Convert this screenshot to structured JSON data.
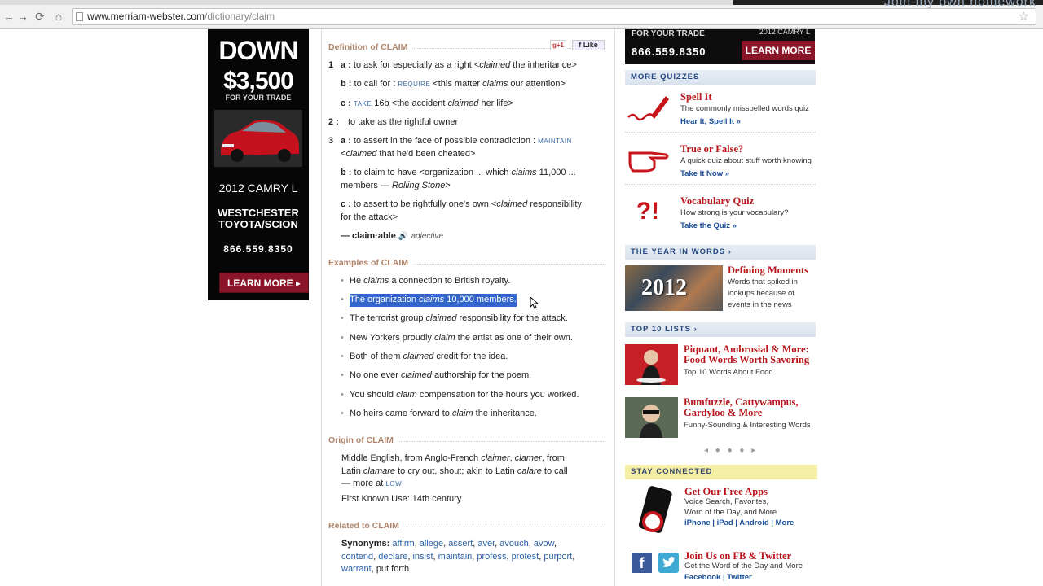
{
  "browser": {
    "tab_text": "Join my own homework",
    "url_host": "www.merriam-webster.com",
    "url_path": "/dictionary/claim",
    "back": "←",
    "forward": "→",
    "reload": "⟳",
    "home": "⌂",
    "star": "☆"
  },
  "left_ad": {
    "down": "DOWN",
    "amount": "$3,500",
    "for_trade": "FOR YOUR TRADE",
    "model": "2012 CAMRY L",
    "dealer": "WESTCHESTER TOYOTA/SCION",
    "phone": "866.559.8350",
    "learn_more": "LEARN MORE ▸"
  },
  "definition": {
    "heading": "Definition of CLAIM",
    "gplus": "g+1",
    "fb_like": "f Like",
    "senses": [
      {
        "num": "1",
        "letter": "a :",
        "text": "to ask for especially as a right <",
        "em": "claimed",
        "rest": " the inheritance>"
      },
      {
        "letter": "b :",
        "pre": "to call for : ",
        "sc": "REQUIRE",
        "text": " <this matter ",
        "em": "claims",
        "rest": " our attention>"
      },
      {
        "letter": "c :",
        "sc": "TAKE",
        "text": " 16b <the accident ",
        "em": "claimed",
        "rest": " her life>"
      },
      {
        "num": "2 :",
        "text": "to take as the rightful owner"
      },
      {
        "num": "3",
        "letter": "a :",
        "text": "to assert in the face of possible contradiction : ",
        "sc": "MAINTAIN",
        "line2_pre": "<",
        "em": "claimed",
        "rest": " that he'd been cheated>"
      },
      {
        "letter": "b :",
        "text": "to claim to have <organization ... which ",
        "em": "claims",
        "rest": " 11,000 ...",
        "line2_pre": "members — ",
        "em2": "Rolling Stone",
        "line2_post": ">"
      },
      {
        "letter": "c :",
        "text": "to assert to be rightfully one's own <",
        "em": "claimed",
        "rest": " responsibility",
        "line2_pre": "for the attack>"
      }
    ],
    "derived_word": "— claim·able",
    "derived_pos": "adjective",
    "speaker_icon": "🔊"
  },
  "examples": {
    "heading": "Examples of CLAIM",
    "items": [
      {
        "pre": "He ",
        "em": "claims",
        "post": " a connection to British royalty."
      },
      {
        "pre": "The organization ",
        "em": "claims",
        "post": " 10,000 members."
      },
      {
        "pre": "The terrorist group ",
        "em": "claimed",
        "post": " responsibility for the attack."
      },
      {
        "pre": "New Yorkers proudly ",
        "em": "claim",
        "post": " the artist as one of their own."
      },
      {
        "pre": "Both of them ",
        "em": "claimed",
        "post": " credit for the idea."
      },
      {
        "pre": "No one ever ",
        "em": "claimed",
        "post": " authorship for the poem."
      },
      {
        "pre": "You should ",
        "em": "claim",
        "post": " compensation for the hours you worked."
      },
      {
        "pre": "No heirs came forward to ",
        "em": "claim",
        "post": " the inheritance."
      }
    ]
  },
  "origin": {
    "heading": "Origin of CLAIM",
    "l1_pre": "Middle English, from Anglo-French ",
    "l1_em1": "claimer",
    "l1_sep": ", ",
    "l1_em2": "clamer",
    "l1_post": ", from",
    "l2_pre": "Latin ",
    "l2_em1": "clamare",
    "l2_mid": " to cry out, shout; akin to Latin ",
    "l2_em2": "calare",
    "l2_post": " to call",
    "l3_pre": "— more at ",
    "l3_sc": "LOW",
    "first_use": "First Known Use: 14th century"
  },
  "related": {
    "heading": "Related to CLAIM",
    "label": "Synonyms:",
    "synonyms_line1": [
      "affirm",
      "allege",
      "assert",
      "aver",
      "avouch",
      "avow"
    ],
    "synonyms_line2": [
      "contend",
      "declare",
      "insist",
      "maintain",
      "profess",
      "protest",
      "purport"
    ],
    "synonyms_line3": [
      "warrant"
    ],
    "last_plain": "put forth"
  },
  "right_ad": {
    "for_trade": "FOR YOUR TRADE",
    "model": "2012 CAMRY L",
    "phone": "866.559.8350",
    "learn_more": "LEARN MORE ▸"
  },
  "more_quizzes": {
    "heading": "MORE QUIZZES",
    "items": [
      {
        "title": "Spell It",
        "desc": "The commonly misspelled words quiz",
        "link": "Hear It, Spell It »"
      },
      {
        "title": "True or False?",
        "desc": "A quick quiz about stuff worth knowing",
        "link": "Take It Now »"
      },
      {
        "title": "Vocabulary Quiz",
        "desc": "How strong is your vocabulary?",
        "link": "Take the Quiz »",
        "icon_text": "?!"
      }
    ]
  },
  "year_in_words": {
    "heading": "THE YEAR IN WORDS ›",
    "image_text": "2012",
    "title": "Defining Moments",
    "desc": "Words that spiked in lookups because of events in the news"
  },
  "top10": {
    "heading": "TOP 10 LISTS ›",
    "items": [
      {
        "title": "Piquant, Ambrosial & More: Food Words Worth Savoring",
        "desc": "Top 10 Words About Food"
      },
      {
        "title": "Bumfuzzle, Cattywampus, Gardyloo & More",
        "desc": "Funny-Sounding & Interesting Words"
      }
    ],
    "pager": "◂ ● ● ● ▸"
  },
  "stay_connected": {
    "heading": "STAY CONNECTED",
    "apps_title": "Get Our Free Apps",
    "apps_desc1": "Voice Search, Favorites,",
    "apps_desc2": "Word of the Day, and More",
    "apps_links": "iPhone | iPad | Android | More",
    "fb_title": "Join Us on FB & Twitter",
    "fb_desc": "Get the Word of the Day and More",
    "fb_links": "Facebook | Twitter"
  }
}
